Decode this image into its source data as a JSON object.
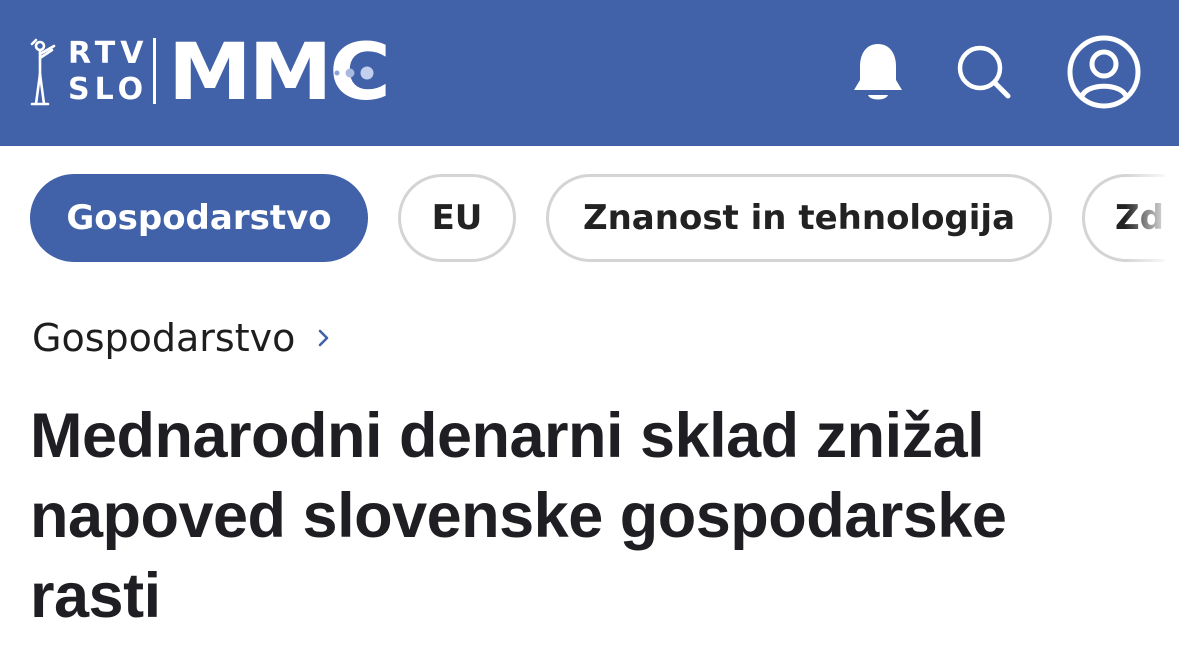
{
  "header": {
    "logo": {
      "rtv_line1": "RTV",
      "rtv_line2": "SLO",
      "brand": "MMC"
    },
    "icons": {
      "notifications": "bell-icon",
      "search": "search-icon",
      "account": "user-icon"
    },
    "colors": {
      "background": "#4161a9",
      "foreground": "#ffffff"
    }
  },
  "tabs": [
    {
      "label": "Gospodarstvo",
      "active": true
    },
    {
      "label": "EU",
      "active": false
    },
    {
      "label": "Znanost in tehnologija",
      "active": false
    },
    {
      "label": "Zd",
      "active": false
    }
  ],
  "breadcrumb": {
    "label": "Gospodarstvo",
    "icon": "chevron-right-icon"
  },
  "article": {
    "title_line1": "Mednarodni denarni sklad znižal",
    "title_line2": "napoved slovenske gospodarske",
    "title_line3": "rasti"
  }
}
